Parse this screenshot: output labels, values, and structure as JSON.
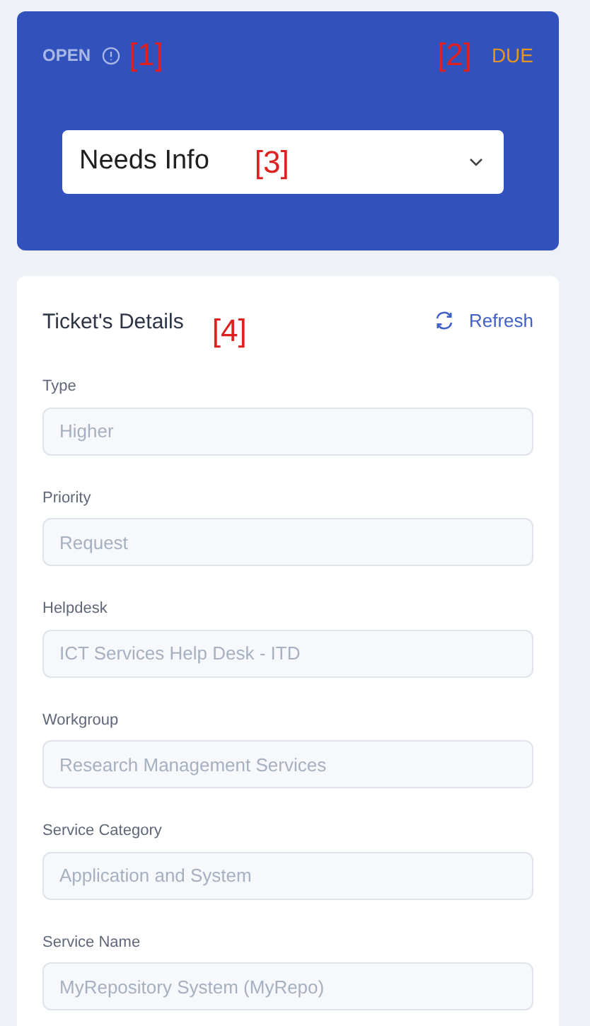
{
  "status_card": {
    "status": "OPEN",
    "status_annotation": "[1]",
    "due_annotation": "[2]",
    "due": "DUE",
    "select": {
      "value": "Needs Info",
      "annotation": "[3]"
    }
  },
  "details": {
    "title": "Ticket's Details",
    "annotation": "[4]",
    "refresh": "Refresh",
    "fields": [
      {
        "label": "Type",
        "placeholder": "Higher"
      },
      {
        "label": "Priority",
        "placeholder": "Request"
      },
      {
        "label": "Helpdesk",
        "placeholder": "ICT Services Help Desk - ITD"
      },
      {
        "label": "Workgroup",
        "placeholder": "Research Management Services"
      },
      {
        "label": "Service Category",
        "placeholder": "Application and System"
      },
      {
        "label": "Service Name",
        "placeholder": "MyRepository System (MyRepo)"
      }
    ]
  }
}
